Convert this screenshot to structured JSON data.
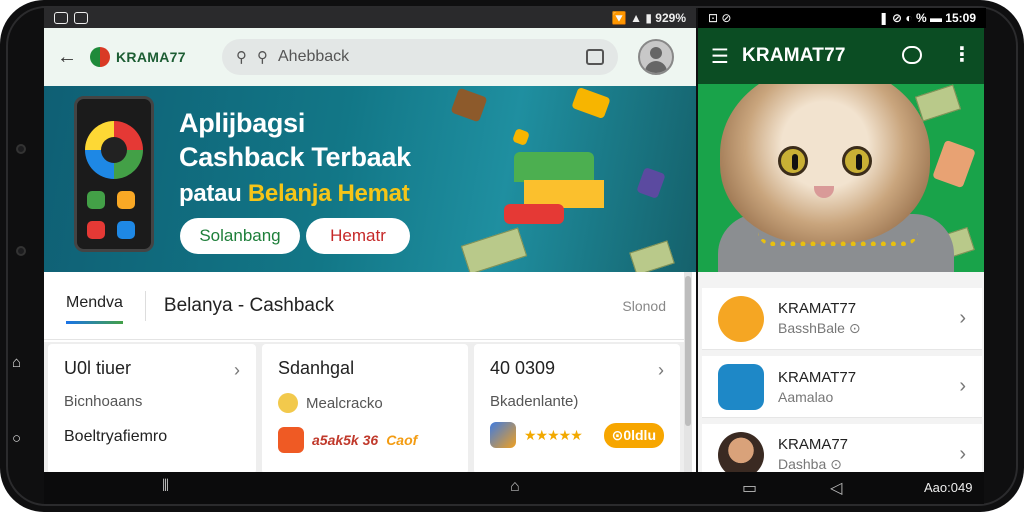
{
  "status": {
    "left_right": "🔽 ▲ ▮ 929%",
    "right_left": "⊡ ⊘",
    "right_right": "❚ ⊘ ◐ % ▬ 15:09"
  },
  "left_app": {
    "brand": "KRAMA77",
    "search": {
      "placeholder": "Ahebback"
    },
    "banner": {
      "line1": "Aplijbagsi",
      "line2": "Cashback Terbaak",
      "line3_prefix": "patau",
      "line3_highlight": "Belanja Hemat",
      "pill1": "Solanbang",
      "pill2": "Hematr"
    },
    "tabs": {
      "active": "Mendva",
      "title": "Belanya - Cashback",
      "right": "Slonod"
    },
    "cards": [
      {
        "title": "U0l tiuer",
        "sub": "Bicnhoaans",
        "extra": "Boeltryafiemro"
      },
      {
        "title": "Sdanhgal",
        "sub": "Mealcracko",
        "extra": "a5ak5k 36",
        "extra2": "Caof"
      },
      {
        "title": "40 0309",
        "sub": "Bkadenlante)",
        "stars": "★★★★★",
        "badge": "⊙0ldlu"
      }
    ]
  },
  "right_app": {
    "title": "KRAMAT77",
    "list": [
      {
        "name": "KRAMAT77",
        "desc": "BasshBale ⊙"
      },
      {
        "name": "KRAMAT77",
        "desc": "Aamalao"
      },
      {
        "name": "KRAMA77",
        "desc": "Dashba ⊙"
      }
    ]
  },
  "navbar": {
    "time": "Aao:049"
  },
  "colors": {
    "brand_green": "#0b4d23",
    "accent_yellow": "#f5c518",
    "banner_teal": "#127787"
  }
}
